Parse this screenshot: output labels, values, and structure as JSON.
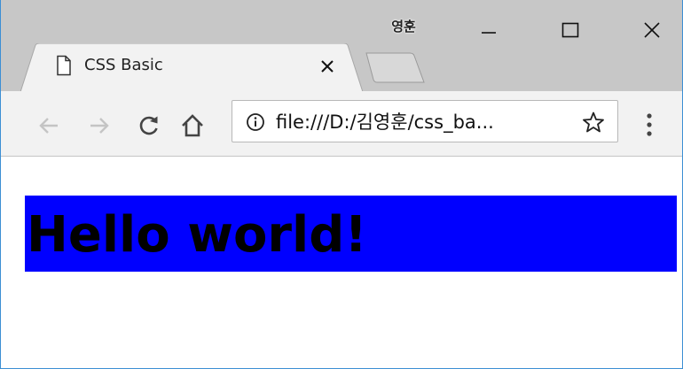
{
  "window": {
    "profile_name": "영훈"
  },
  "tab": {
    "title": "CSS Basic"
  },
  "toolbar": {
    "url": "file:///D:/김영훈/css_ba..."
  },
  "page": {
    "heading": "Hello world!"
  },
  "colors": {
    "heading_background": "#0000ff",
    "heading_text": "#000000",
    "titlebar": "#c7c7c7",
    "toolbar": "#f2f2f2"
  },
  "icons": {
    "tab": "document-icon",
    "tab_close": "close-icon",
    "back": "back-arrow-icon",
    "forward": "forward-arrow-icon",
    "reload": "reload-icon",
    "home": "home-icon",
    "info": "info-icon",
    "bookmark": "star-icon",
    "menu": "kebab-menu-icon"
  }
}
